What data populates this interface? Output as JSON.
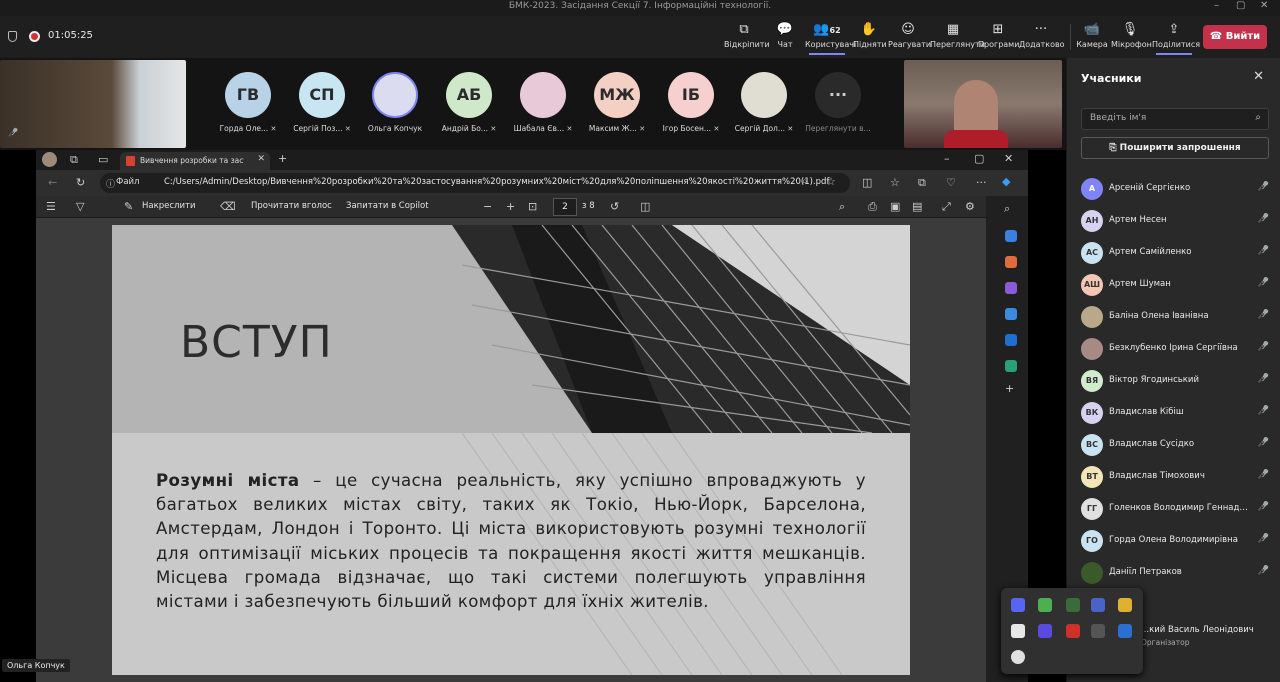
{
  "window_title": "БМК-2023. Засідання Секції 7. Інформаційні технології.",
  "timer": "01:05:25",
  "toolbar": {
    "items": [
      {
        "label": "Відкріпити",
        "icon": "unpin-icon"
      },
      {
        "label": "Чат",
        "icon": "chat-icon"
      },
      {
        "label": "Користувачі",
        "icon": "people-icon",
        "count": "62"
      },
      {
        "label": "Підняти",
        "icon": "raise-hand-icon"
      },
      {
        "label": "Реагувати",
        "icon": "react-icon"
      },
      {
        "label": "Переглянути",
        "icon": "view-icon"
      },
      {
        "label": "Програми",
        "icon": "apps-icon"
      },
      {
        "label": "Додатково",
        "icon": "more-icon"
      },
      {
        "label": "Камера",
        "icon": "camera-icon"
      },
      {
        "label": "Мікрофон",
        "icon": "mic-icon"
      },
      {
        "label": "Поділитися",
        "icon": "share-icon"
      }
    ],
    "leave_label": "Вийти"
  },
  "strip": {
    "participants": [
      {
        "initials": "ГВ",
        "name": "Горда Оле...",
        "color": "#b8d3e8"
      },
      {
        "initials": "СП",
        "name": "Сергій Поз...",
        "color": "#c7e6f2"
      },
      {
        "initials": "",
        "name": "Ольга Копчук",
        "color": "#dcdcf0"
      },
      {
        "initials": "АБ",
        "name": "Андрій Бо...",
        "color": "#cfe8c9"
      },
      {
        "initials": "",
        "name": "Шабала Єв...",
        "color": "#e8c9d8"
      },
      {
        "initials": "МЖ",
        "name": "Максим Ж...",
        "color": "#f4cfc4"
      },
      {
        "initials": "ІБ",
        "name": "Ігор Босен...",
        "color": "#f6cfcf"
      },
      {
        "initials": "",
        "name": "Сергій Дол...",
        "color": "#e0ddd2"
      }
    ],
    "more_label": "Переглянути в..."
  },
  "panel": {
    "title": "Учасники",
    "search_placeholder": "Введіть ім'я",
    "share_invite": "Поширити запрошення",
    "people": [
      {
        "initials": "А",
        "name": "Арсеній Сергієнко",
        "color": "#7f85f5"
      },
      {
        "initials": "АН",
        "name": "Артем Несен",
        "color": "#d6d2f0"
      },
      {
        "initials": "АС",
        "name": "Артем Самійленко",
        "color": "#c9e3f2"
      },
      {
        "initials": "АШ",
        "name": "Артем Шуман",
        "color": "#f4c6b4"
      },
      {
        "initials": "",
        "name": "Баліна Олена Іванівна",
        "color": "#b9a98a"
      },
      {
        "initials": "",
        "name": "Безклубенко Ірина Сергіївна",
        "color": "#a88a84"
      },
      {
        "initials": "ВЯ",
        "name": "Віктор Ягодинський",
        "color": "#d2ebcc"
      },
      {
        "initials": "ВК",
        "name": "Владислав Кібіш",
        "color": "#d6d2f0"
      },
      {
        "initials": "ВС",
        "name": "Владислав Сусідко",
        "color": "#c9e3f2"
      },
      {
        "initials": "ВТ",
        "name": "Владислав Тімохович",
        "color": "#f2e6b8"
      },
      {
        "initials": "ГГ",
        "name": "Голенков Володимир Геннадій...",
        "color": "#e0e0e0"
      },
      {
        "initials": "ГО",
        "name": "Горда Олена Володимирівна",
        "color": "#c9e3f2"
      },
      {
        "initials": "",
        "name": "Даніїл Петраков",
        "color": "#3b5a2a"
      }
    ],
    "partial_name": "...кий Василь Леонідович",
    "partial_role": "Організатор"
  },
  "browser": {
    "tab_title": "Вивчення розробки та застосу",
    "file_label": "Файл",
    "url": "C:/Users/Admin/Desktop/Вивчення%20розробки%20та%20застосування%20розумних%20міст%20для%20поліпшення%20якості%20життя%20(1).pdf",
    "draw_label": "Накреслити",
    "read_aloud": "Прочитати вголос",
    "ask_copilot": "Запитати в Copilot",
    "page_number": "2",
    "page_total": "з 8"
  },
  "slide": {
    "title": "ВСТУП",
    "lead": "Розумні міста",
    "body": " – це сучасна реальність, яку успішно впроваджують у багатьох великих містах світу, таких як Токіо, Нью-Йорк, Барселона, Амстердам, Лондон і Торонто. Ці міста використовують розумні технології для оптимізації міських процесів та покращення якості життя мешканців. Місцева громада відзначає, що такі системи полегшують управління містами і забезпечують більший комфорт для їхніх жителів."
  },
  "self_label": "Ольга Копчук",
  "colors": {
    "leave": "#c4314b",
    "accent": "#7f85f5"
  }
}
